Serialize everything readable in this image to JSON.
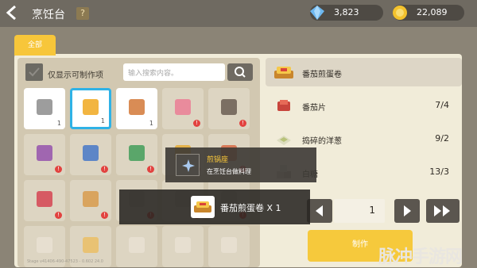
{
  "header": {
    "title": "烹饪台",
    "help_label": "?",
    "gems": "3,823",
    "coins": "22,089"
  },
  "tabs": [
    {
      "label": "全部"
    }
  ],
  "filter": {
    "label": "仅显示可制作项",
    "checked": true
  },
  "search": {
    "placeholder": "输入搜索内容。"
  },
  "grid": {
    "rows": [
      [
        {
          "color": "#9d9d9d",
          "count": "1",
          "state": "available"
        },
        {
          "color": "#f2b541",
          "count": "1",
          "state": "selected"
        },
        {
          "color": "#d98c55",
          "count": "1",
          "state": "available"
        },
        {
          "color": "#e98b9c",
          "count": "",
          "state": "locked"
        },
        {
          "color": "#7b6f63",
          "count": "",
          "state": "locked"
        }
      ],
      [
        {
          "color": "#a066b0",
          "count": "",
          "state": "locked"
        },
        {
          "color": "#5d86c7",
          "count": "",
          "state": "locked"
        },
        {
          "color": "#5aa66a",
          "count": "",
          "state": "locked"
        },
        {
          "color": "#e4b24a",
          "count": "",
          "state": "locked"
        },
        {
          "color": "#d87a58",
          "count": "",
          "state": "locked"
        }
      ],
      [
        {
          "color": "#d65a63",
          "count": "",
          "state": "locked"
        },
        {
          "color": "#d9a45e",
          "count": "",
          "state": "locked"
        },
        {
          "color": "#cfc6b1",
          "count": "",
          "state": "locked"
        },
        {
          "color": "#cfc6b1",
          "count": "",
          "state": "locked"
        },
        {
          "color": "#cfc6b1",
          "count": "",
          "state": "locked"
        }
      ],
      [
        {
          "color": "#e7dfd0",
          "count": "",
          "state": "locked"
        },
        {
          "color": "#e9c273",
          "count": "",
          "state": "locked"
        },
        {
          "color": "#e7dfd0",
          "count": "",
          "state": "locked"
        },
        {
          "color": "#e7dfd0",
          "count": "",
          "state": "locked"
        },
        {
          "color": "#e7dfd0",
          "count": "",
          "state": "locked"
        }
      ]
    ]
  },
  "recipe": {
    "name": "番茄煎蛋卷",
    "ingredients": [
      {
        "name": "番茄片",
        "have": "7/4",
        "icon": "tomato-slice-icon"
      },
      {
        "name": "捣碎的洋葱",
        "have": "9/2",
        "icon": "onion-icon"
      },
      {
        "name": "白糖",
        "have": "13/3",
        "icon": "sugar-icon"
      }
    ],
    "quantity": "1",
    "make_label": "制作"
  },
  "tooltip": {
    "title": "煎锅座",
    "subtitle": "在烹饪台做料理"
  },
  "notice": {
    "text": "番茄煎蛋卷 X 1"
  },
  "watermark": "脉冲手游网",
  "version": "Stage v41406-490-47523 - 0.602 24.0"
}
